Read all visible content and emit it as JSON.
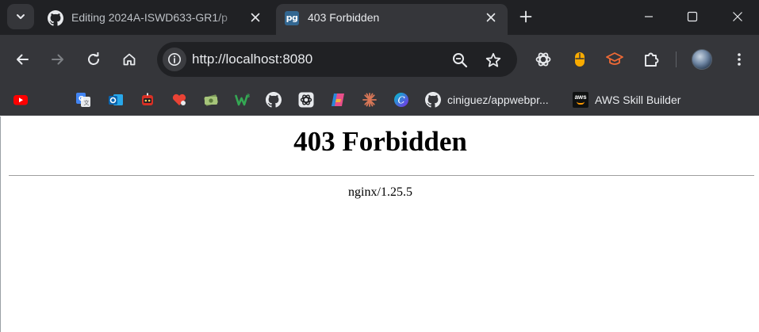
{
  "tabs": [
    {
      "title": "Editing 2024A-ISWD633-GR1/p",
      "favicon": "github-icon",
      "active": false
    },
    {
      "title": "403 Forbidden",
      "favicon": "postgres-pg-icon",
      "favicon_text": "pg",
      "active": true
    }
  ],
  "toolbar": {
    "url": "http://localhost:8080",
    "extensions": [
      "openai-icon",
      "mouse-extension-icon",
      "mortarboard-extension-icon",
      "puzzle-extensions-icon"
    ]
  },
  "bookmarks": [
    {
      "icon": "youtube-icon",
      "label": ""
    },
    {
      "icon": "google-translate-icon",
      "label": ""
    },
    {
      "icon": "outlook-icon",
      "label": ""
    },
    {
      "icon": "robot-icon",
      "label": ""
    },
    {
      "icon": "heart-tag-icon",
      "label": ""
    },
    {
      "icon": "money-icon",
      "label": ""
    },
    {
      "icon": "w-logo-icon",
      "label": ""
    },
    {
      "icon": "github-icon",
      "label": ""
    },
    {
      "icon": "openai-icon",
      "label": ""
    },
    {
      "icon": "copilot-icon",
      "label": ""
    },
    {
      "icon": "claude-icon",
      "label": ""
    },
    {
      "icon": "canva-icon",
      "label": ""
    },
    {
      "icon": "github-icon",
      "label": "ciniguez/appwebpr..."
    },
    {
      "icon": "aws-icon",
      "label": "AWS Skill Builder",
      "icon_text": "aws"
    }
  ],
  "page": {
    "heading": "403 Forbidden",
    "server": "nginx/1.25.5"
  },
  "colors": {
    "tabstrip": "#202124",
    "toolbar": "#35363a",
    "omnibox": "#202124",
    "text": "#e8eaed",
    "postgres_blue": "#336791"
  }
}
